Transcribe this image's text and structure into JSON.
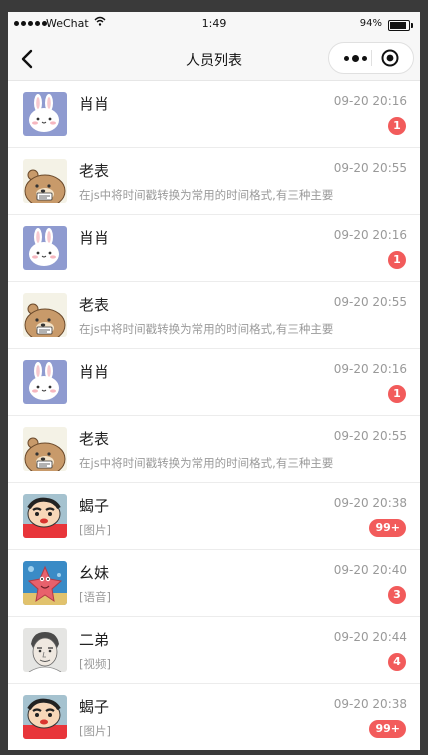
{
  "status_bar": {
    "carrier": "WeChat",
    "time": "1:49",
    "battery": "94%"
  },
  "navbar": {
    "title": "人员列表"
  },
  "icons": {
    "back": "chevron-left-icon",
    "more": "more-dots-icon",
    "close": "target-circle-icon"
  },
  "colors": {
    "badge": "#f25b5b",
    "nav_background": "#f7f7f7"
  },
  "conversations": [
    {
      "name": "肖肖",
      "time": "09-20 20:16",
      "preview": "",
      "badge": "1",
      "avatar": "bunny"
    },
    {
      "name": "老表",
      "time": "09-20 20:55",
      "preview": "在js中将时间戳转换为常用的时间格式,有三种主要",
      "badge": "",
      "avatar": "bear"
    },
    {
      "name": "肖肖",
      "time": "09-20 20:16",
      "preview": "",
      "badge": "1",
      "avatar": "bunny"
    },
    {
      "name": "老表",
      "time": "09-20 20:55",
      "preview": "在js中将时间戳转换为常用的时间格式,有三种主要",
      "badge": "",
      "avatar": "bear"
    },
    {
      "name": "肖肖",
      "time": "09-20 20:16",
      "preview": "",
      "badge": "1",
      "avatar": "bunny"
    },
    {
      "name": "老表",
      "time": "09-20 20:55",
      "preview": "在js中将时间戳转换为常用的时间格式,有三种主要",
      "badge": "",
      "avatar": "bear"
    },
    {
      "name": "蝎子",
      "time": "09-20 20:38",
      "preview": "[图片]",
      "badge": "99+",
      "avatar": "shinchan"
    },
    {
      "name": "幺妹",
      "time": "09-20 20:40",
      "preview": "[语音]",
      "badge": "3",
      "avatar": "patrick"
    },
    {
      "name": "二弟",
      "time": "09-20 20:44",
      "preview": "[视频]",
      "badge": "4",
      "avatar": "sketch"
    },
    {
      "name": "蝎子",
      "time": "09-20 20:38",
      "preview": "[图片]",
      "badge": "99+",
      "avatar": "shinchan"
    }
  ]
}
